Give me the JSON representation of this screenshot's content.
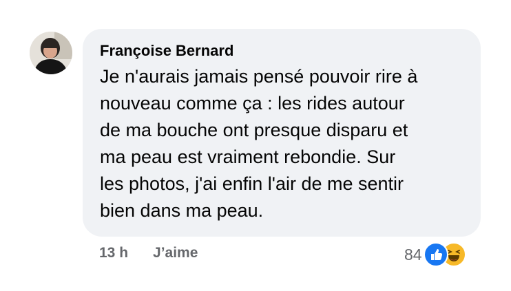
{
  "comment": {
    "author": "Françoise Bernard",
    "lines": [
      "Je n'aurais jamais pensé pouvoir rire à",
      "nouveau comme ça : les rides autour",
      "de ma bouche ont presque disparu et",
      "ma peau est vraiment rebondie. Sur",
      "les photos, j'ai enfin l'air de me sentir",
      "bien dans ma peau."
    ],
    "time": "13 h",
    "like_label": "J’aime",
    "reaction_count": "84",
    "reactions": [
      "like-icon",
      "haha-icon"
    ]
  },
  "colors": {
    "bubble": "#f0f2f5",
    "meta_text": "#65676b",
    "like_blue": "#1877f2",
    "haha_yellow": "#f7b928"
  }
}
